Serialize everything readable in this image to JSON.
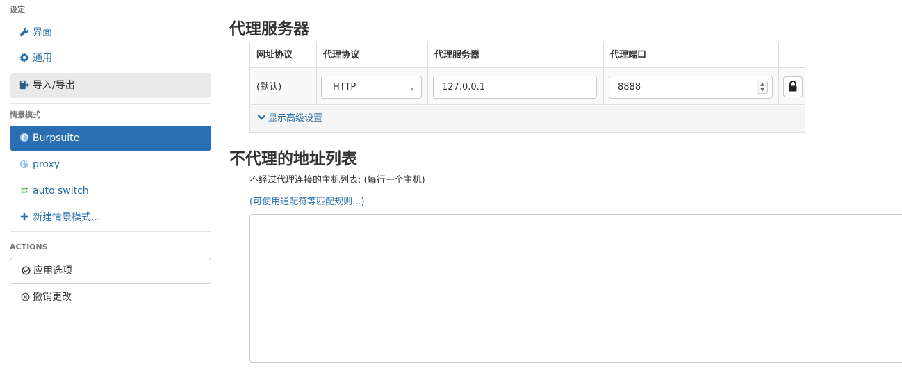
{
  "sidebar": {
    "settings_header": "设定",
    "settings_items": [
      {
        "label": "界面",
        "icon": "wrench-icon"
      },
      {
        "label": "通用",
        "icon": "gear-icon"
      },
      {
        "label": "导入/导出",
        "icon": "import-export-icon"
      }
    ],
    "profiles_header": "情景模式",
    "profiles": [
      {
        "label": "Burpsuite",
        "icon": "globe-icon"
      },
      {
        "label": "proxy",
        "icon": "globe-icon"
      },
      {
        "label": "auto switch",
        "icon": "refresh-icon"
      },
      {
        "label": "新建情景模式...",
        "icon": "plus-icon"
      }
    ],
    "actions_header": "ACTIONS",
    "apply_label": "应用选项",
    "revert_label": "撤销更改"
  },
  "main": {
    "proxy_title": "代理服务器",
    "table": {
      "headers": [
        "网址协议",
        "代理协议",
        "代理服务器",
        "代理端口"
      ],
      "row": {
        "scheme": "(默认)",
        "protocol": "HTTP",
        "server": "127.0.0.1",
        "port": "8888"
      },
      "advanced_label": "显示高级设置"
    },
    "bypass_title": "不代理的地址列表",
    "bypass_help": "不经过代理连接的主机列表: (每行一个主机)",
    "bypass_rule_link": "(可使用通配符等匹配规则...)"
  },
  "colors": {
    "accent": "#2a6fa8",
    "active_profile_bg": "#2a6eb3",
    "active_nav_bg": "#e9e9e9",
    "auto_switch_icon": "#4caf50"
  }
}
